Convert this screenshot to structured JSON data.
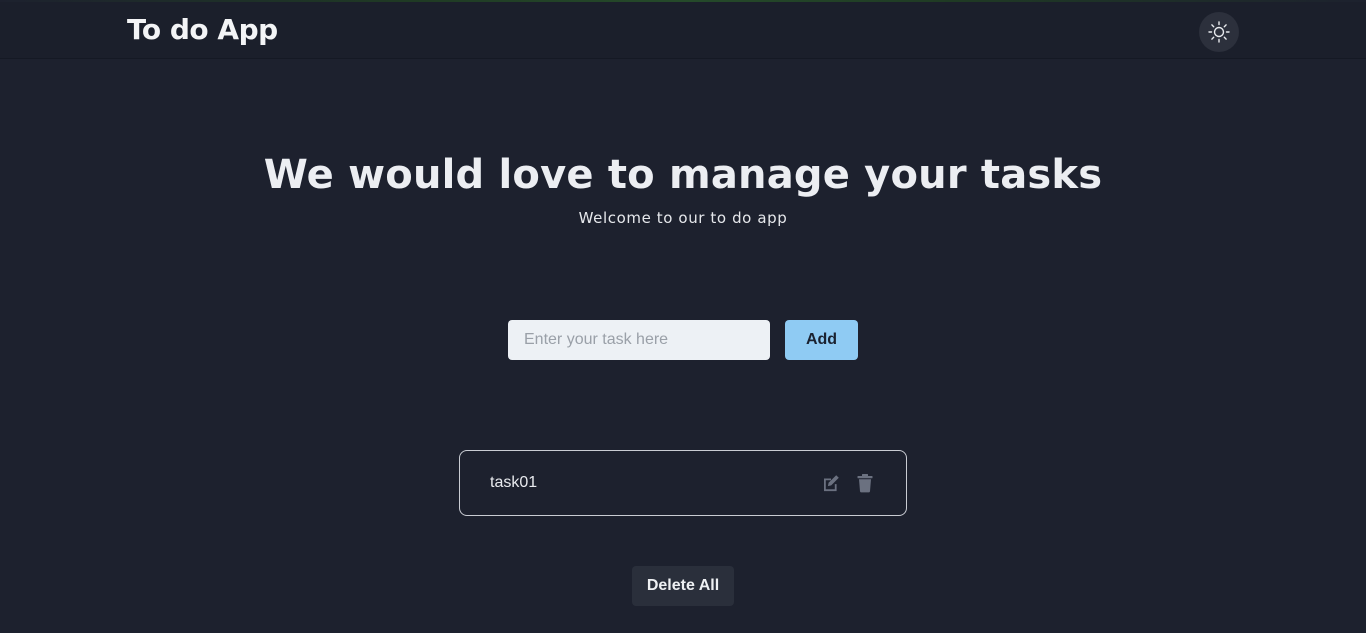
{
  "header": {
    "brand": "To do App",
    "theme_toggle_icon": "sun-icon"
  },
  "hero": {
    "title": "We would love to manage your tasks",
    "subtitle": "Welcome to our to do app"
  },
  "form": {
    "placeholder": "Enter your task here",
    "value": "",
    "add_label": "Add"
  },
  "tasks": [
    {
      "text": "task01",
      "edit_icon": "edit-icon",
      "delete_icon": "trash-icon"
    }
  ],
  "footer": {
    "delete_all_label": "Delete All"
  },
  "colors": {
    "background": "#1d212e",
    "navbar": "#1b1f2b",
    "accent": "#8fcbf3",
    "icon_muted": "#6b7180"
  }
}
